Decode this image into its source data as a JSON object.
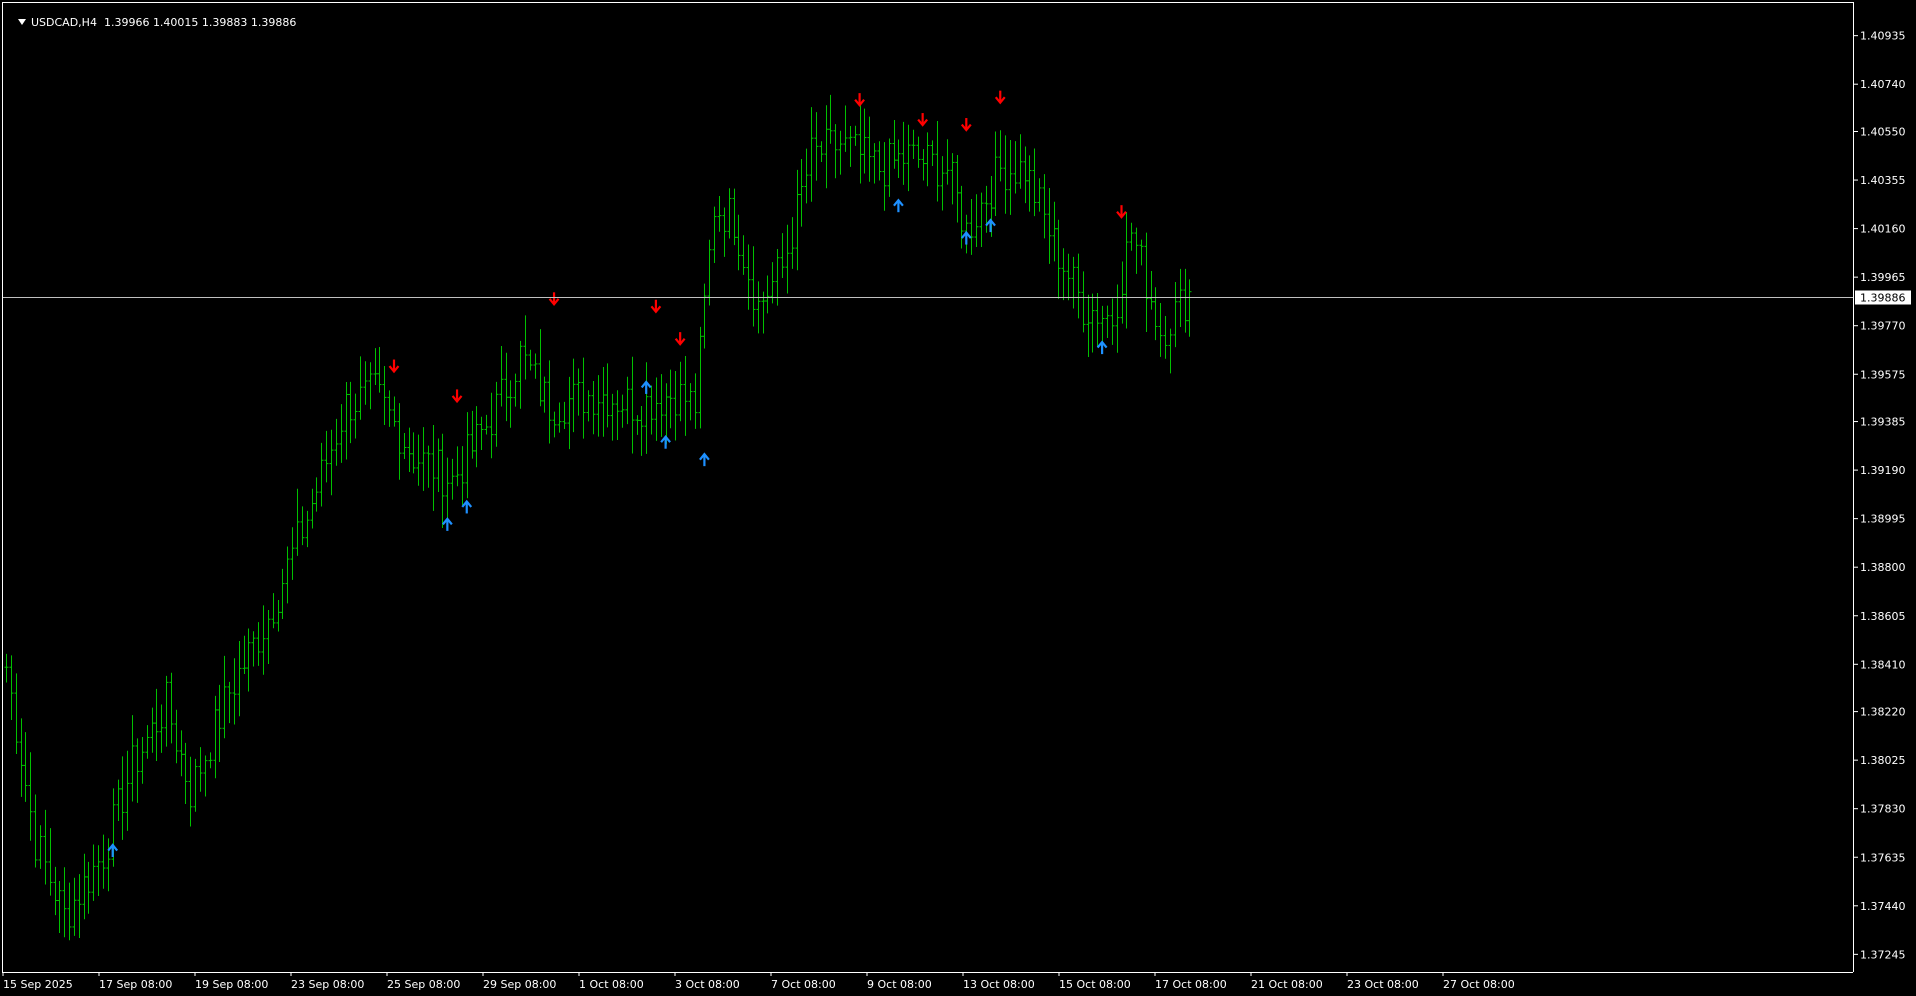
{
  "header": {
    "symbol_timeframe": "USDCAD,H4",
    "quote": "1.39966 1.40015 1.39883 1.39886"
  },
  "price_axis": {
    "ticks": [
      "1.40935",
      "1.40740",
      "1.40550",
      "1.40355",
      "1.40160",
      "1.39965",
      "1.39770",
      "1.39575",
      "1.39385",
      "1.39190",
      "1.38995",
      "1.38800",
      "1.38605",
      "1.38410",
      "1.38220",
      "1.38025",
      "1.37830",
      "1.37635",
      "1.37440",
      "1.37245"
    ],
    "current_price": "1.39886"
  },
  "time_axis": {
    "labels": [
      "15 Sep 2025",
      "17 Sep 08:00",
      "19 Sep 08:00",
      "23 Sep 08:00",
      "25 Sep 08:00",
      "29 Sep 08:00",
      "1 Oct 08:00",
      "3 Oct 08:00",
      "7 Oct 08:00",
      "9 Oct 08:00",
      "13 Oct 08:00",
      "15 Oct 08:00",
      "17 Oct 08:00",
      "21 Oct 08:00",
      "23 Oct 08:00",
      "27 Oct 08:00"
    ]
  },
  "colors": {
    "background": "#000000",
    "bar": "#00c000",
    "axis": "#ffffff",
    "arrow_up": "#1e90ff",
    "arrow_down": "#ff0000",
    "price_line": "#c0c0c0"
  },
  "chart_data": {
    "type": "ohlc",
    "symbol": "USDCAD",
    "timeframe": "H4",
    "ylim": [
      1.3715,
      1.4103
    ],
    "key_points": [
      {
        "bar": 0,
        "price": 1.384
      },
      {
        "bar": 6,
        "price": 1.377
      },
      {
        "bar": 12,
        "price": 1.374
      },
      {
        "bar": 20,
        "price": 1.3765
      },
      {
        "bar": 26,
        "price": 1.38
      },
      {
        "bar": 33,
        "price": 1.3825
      },
      {
        "bar": 38,
        "price": 1.379
      },
      {
        "bar": 46,
        "price": 1.383
      },
      {
        "bar": 54,
        "price": 1.386
      },
      {
        "bar": 62,
        "price": 1.39
      },
      {
        "bar": 70,
        "price": 1.3945
      },
      {
        "bar": 76,
        "price": 1.395
      },
      {
        "bar": 84,
        "price": 1.3925
      },
      {
        "bar": 92,
        "price": 1.3915
      },
      {
        "bar": 100,
        "price": 1.394
      },
      {
        "bar": 106,
        "price": 1.3965
      },
      {
        "bar": 112,
        "price": 1.3945
      },
      {
        "bar": 122,
        "price": 1.395
      },
      {
        "bar": 130,
        "price": 1.3945
      },
      {
        "bar": 138,
        "price": 1.395
      },
      {
        "bar": 142,
        "price": 1.3945
      },
      {
        "bar": 146,
        "price": 1.4025
      },
      {
        "bar": 150,
        "price": 1.402
      },
      {
        "bar": 155,
        "price": 1.3985
      },
      {
        "bar": 160,
        "price": 1.4
      },
      {
        "bar": 166,
        "price": 1.4045
      },
      {
        "bar": 172,
        "price": 1.405
      },
      {
        "bar": 180,
        "price": 1.404
      },
      {
        "bar": 186,
        "price": 1.4045
      },
      {
        "bar": 194,
        "price": 1.404
      },
      {
        "bar": 198,
        "price": 1.4015
      },
      {
        "bar": 205,
        "price": 1.404
      },
      {
        "bar": 210,
        "price": 1.404
      },
      {
        "bar": 216,
        "price": 1.401
      },
      {
        "bar": 222,
        "price": 1.3985
      },
      {
        "bar": 228,
        "price": 1.398
      },
      {
        "bar": 232,
        "price": 1.4015
      },
      {
        "bar": 238,
        "price": 1.3975
      },
      {
        "bar": 244,
        "price": 1.399
      }
    ],
    "arrows": [
      {
        "bar": 22,
        "dir": "up",
        "price": 1.3766
      },
      {
        "bar": 80,
        "dir": "down",
        "price": 1.3961
      },
      {
        "bar": 91,
        "dir": "up",
        "price": 1.3897
      },
      {
        "bar": 93,
        "dir": "down",
        "price": 1.3949
      },
      {
        "bar": 95,
        "dir": "up",
        "price": 1.3904
      },
      {
        "bar": 113,
        "dir": "down",
        "price": 1.3988
      },
      {
        "bar": 132,
        "dir": "up",
        "price": 1.3952
      },
      {
        "bar": 134,
        "dir": "down",
        "price": 1.3985
      },
      {
        "bar": 136,
        "dir": "up",
        "price": 1.393
      },
      {
        "bar": 139,
        "dir": "down",
        "price": 1.3972
      },
      {
        "bar": 144,
        "dir": "up",
        "price": 1.3923
      },
      {
        "bar": 176,
        "dir": "down",
        "price": 1.4068
      },
      {
        "bar": 184,
        "dir": "up",
        "price": 1.4025
      },
      {
        "bar": 189,
        "dir": "down",
        "price": 1.406
      },
      {
        "bar": 198,
        "dir": "up",
        "price": 1.4012
      },
      {
        "bar": 198,
        "dir": "down",
        "price": 1.4058
      },
      {
        "bar": 203,
        "dir": "up",
        "price": 1.4017
      },
      {
        "bar": 205,
        "dir": "down",
        "price": 1.4069
      },
      {
        "bar": 226,
        "dir": "up",
        "price": 1.3968
      },
      {
        "bar": 230,
        "dir": "down",
        "price": 1.4023
      }
    ]
  }
}
